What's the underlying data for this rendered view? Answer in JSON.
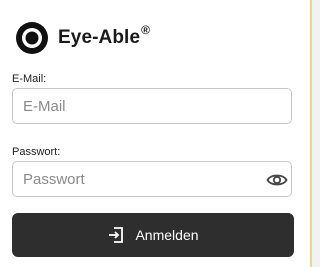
{
  "brand": {
    "name": "Eye-Able",
    "trademark": "®"
  },
  "form": {
    "email": {
      "label": "E-Mail:",
      "placeholder": "E-Mail",
      "value": ""
    },
    "password": {
      "label": "Passwort:",
      "placeholder": "Passwort",
      "value": "",
      "toggle_icon": "eye-icon"
    },
    "submit": {
      "label": "Anmelden",
      "icon": "login-icon"
    }
  },
  "colors": {
    "button_bg": "#2e2e2e",
    "button_text": "#ffffff",
    "input_border": "#c9c9c9",
    "accent_edge": "#e9d98a"
  }
}
